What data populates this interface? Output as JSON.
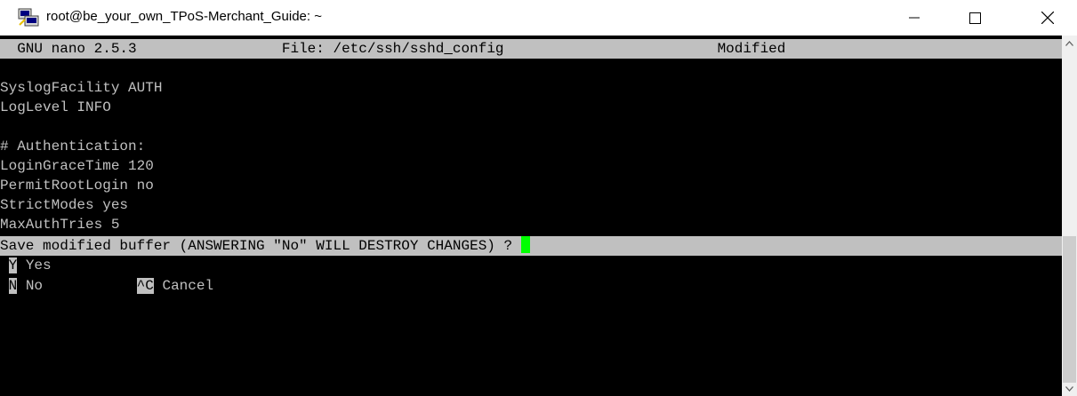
{
  "window": {
    "title": "root@be_your_own_TPoS-Merchant_Guide: ~"
  },
  "icons": {
    "app": "putty-terminal-icon",
    "minimize": "minimize-icon",
    "maximize": "maximize-icon",
    "close": "close-icon",
    "scroll_up": "chevron-up-icon",
    "scroll_down": "chevron-down-icon"
  },
  "nano": {
    "header": {
      "version": "  GNU nano 2.5.3",
      "file_label": "File: /etc/ssh/sshd",
      "file_rest": "config",
      "status": "Modified "
    },
    "lines": [
      "",
      "SyslogFacility AUTH",
      "LogLevel INFO",
      "",
      "# Authentication:",
      "LoginGraceTime 120",
      "PermitRootLogin no",
      "StrictModes yes",
      "MaxAuthTries 5"
    ],
    "prompt": "Save modified buffer (ANSWERING \"No\" WILL DESTROY CHANGES) ? ",
    "options": [
      {
        "key": "Y",
        "label": "Yes"
      },
      {
        "key": "N",
        "label": "No"
      },
      {
        "key": "^C",
        "label": "Cancel"
      }
    ]
  },
  "colors": {
    "terminal_bg": "#000000",
    "terminal_fg": "#c0c0c0",
    "cursor": "#00ff00"
  }
}
